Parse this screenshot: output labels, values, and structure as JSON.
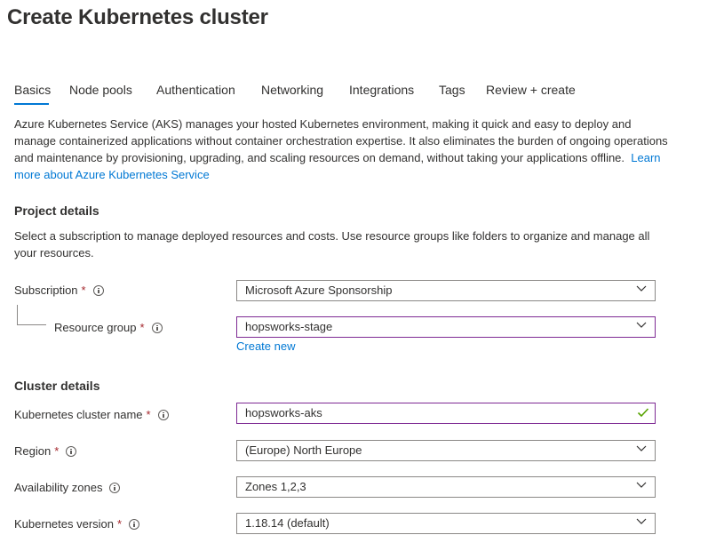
{
  "page": {
    "title": "Create Kubernetes cluster"
  },
  "tabs": [
    "Basics",
    "Node pools",
    "Authentication",
    "Networking",
    "Integrations",
    "Tags",
    "Review + create"
  ],
  "intro": {
    "text": "Azure Kubernetes Service (AKS) manages your hosted Kubernetes environment, making it quick and easy to deploy and manage containerized applications without container orchestration expertise. It also eliminates the burden of ongoing operations and maintenance by provisioning, upgrading, and scaling resources on demand, without taking your applications offline.",
    "link": "Learn more about Azure Kubernetes Service"
  },
  "project": {
    "title": "Project details",
    "description": "Select a subscription to manage deployed resources and costs. Use resource groups like folders to organize and manage all your resources.",
    "subscription": {
      "label": "Subscription",
      "value": "Microsoft Azure Sponsorship"
    },
    "resource_group": {
      "label": "Resource group",
      "value": "hopsworks-stage",
      "create_new": "Create new"
    }
  },
  "cluster": {
    "title": "Cluster details",
    "name": {
      "label": "Kubernetes cluster name",
      "value": "hopsworks-aks"
    },
    "region": {
      "label": "Region",
      "value": "(Europe) North Europe"
    },
    "zones": {
      "label": "Availability zones",
      "value": "Zones 1,2,3"
    },
    "version": {
      "label": "Kubernetes version",
      "value": "1.18.14 (default)"
    }
  },
  "required_mark": "*",
  "colors": {
    "accent": "#0078d4",
    "focus_border": "#7e2a94",
    "required": "#a4262c",
    "valid_check": "#57a300"
  },
  "icons": {
    "info": "info-icon",
    "dropdown": "chevron-down-icon",
    "valid": "checkmark-icon"
  }
}
